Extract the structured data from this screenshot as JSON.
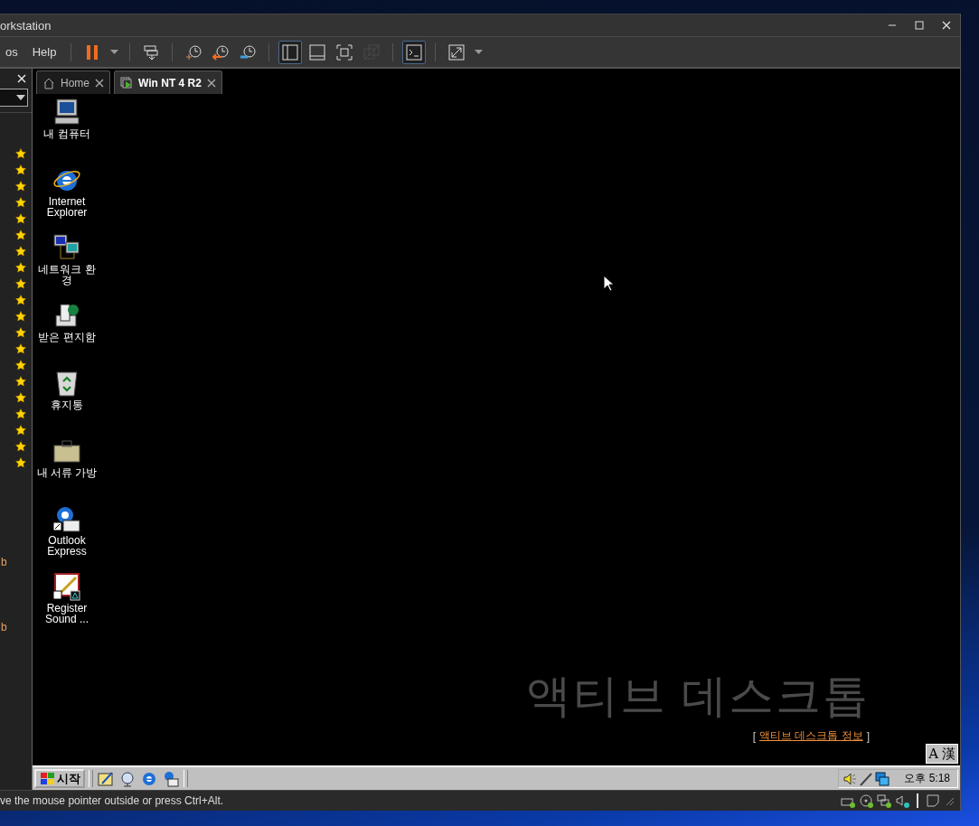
{
  "window": {
    "title": "orkstation"
  },
  "menu": [
    {
      "label": "os"
    },
    {
      "label": "Help"
    }
  ],
  "toolbar": [
    {
      "buttons": [
        {
          "kind": "pause",
          "selected": false,
          "disabled": false
        }
      ]
    },
    {
      "buttons": [
        {
          "kind": "send-keys",
          "selected": false,
          "disabled": false
        }
      ]
    },
    {
      "buttons": [
        {
          "kind": "snapshot",
          "selected": false,
          "disabled": false
        },
        {
          "kind": "revert",
          "selected": false,
          "disabled": false
        },
        {
          "kind": "manage",
          "selected": false,
          "disabled": false
        }
      ]
    },
    {
      "buttons": [
        {
          "kind": "library",
          "selected": true,
          "disabled": false
        },
        {
          "kind": "thumbs",
          "selected": false,
          "disabled": false
        },
        {
          "kind": "fullscreen",
          "selected": false,
          "disabled": false
        },
        {
          "kind": "unity",
          "selected": false,
          "disabled": true
        }
      ]
    },
    {
      "buttons": [
        {
          "kind": "console",
          "selected": true,
          "disabled": false
        }
      ]
    },
    {
      "buttons": [
        {
          "kind": "stretch",
          "selected": false,
          "disabled": false
        }
      ]
    }
  ],
  "sidebar": {
    "items": [
      {
        "favorite": true
      },
      {
        "favorite": true
      },
      {
        "favorite": true
      },
      {
        "favorite": true
      },
      {
        "favorite": true
      },
      {
        "favorite": true
      },
      {
        "favorite": true
      },
      {
        "favorite": true
      },
      {
        "favorite": true
      },
      {
        "favorite": true
      },
      {
        "favorite": true
      },
      {
        "favorite": true
      },
      {
        "favorite": true
      },
      {
        "favorite": true
      },
      {
        "favorite": true
      },
      {
        "favorite": true
      },
      {
        "favorite": true
      },
      {
        "favorite": true
      },
      {
        "favorite": true
      },
      {
        "favorite": true
      }
    ],
    "bottom_items": [
      {
        "text": "b"
      },
      {
        "text": "b"
      }
    ]
  },
  "tabs": [
    {
      "label": "Home",
      "kind": "home",
      "selected": false
    },
    {
      "label": "Win NT 4 R2",
      "kind": "vm",
      "selected": true
    }
  ],
  "desktop": {
    "icons": [
      {
        "label": "내 컴퓨터",
        "kind": "computer"
      },
      {
        "label": "Internet Explorer",
        "kind": "ie"
      },
      {
        "label": "네트워크 환경",
        "kind": "network"
      },
      {
        "label": "받은 편지함",
        "kind": "inbox"
      },
      {
        "label": "휴지통",
        "kind": "recycle"
      },
      {
        "label": "내 서류 가방",
        "kind": "briefcase"
      },
      {
        "label": "Outlook Express",
        "kind": "outlook"
      },
      {
        "label": "Register Sound ...",
        "kind": "register"
      }
    ],
    "watermark": "액티브 데스크톱",
    "info_link": {
      "open": "[",
      "label": "액티브 데스크톱 정보",
      "close": "]"
    },
    "ime": {
      "mode": "A",
      "hanja": "漢"
    }
  },
  "taskbar": {
    "start": "시작",
    "quick_launch": [
      {
        "kind": "desktop"
      },
      {
        "kind": "channel"
      },
      {
        "kind": "ie"
      },
      {
        "kind": "outlook"
      }
    ],
    "tray": [
      {
        "kind": "volume"
      },
      {
        "kind": "pen"
      },
      {
        "kind": "network"
      }
    ],
    "clock": "오후 5:18"
  },
  "status_bar": {
    "message": "ve the mouse pointer outside or press Ctrl+Alt.",
    "devices": [
      {
        "kind": "hdd",
        "active": true
      },
      {
        "kind": "cd",
        "active": true
      },
      {
        "kind": "network",
        "active": true
      },
      {
        "kind": "sound",
        "active": true
      }
    ]
  }
}
